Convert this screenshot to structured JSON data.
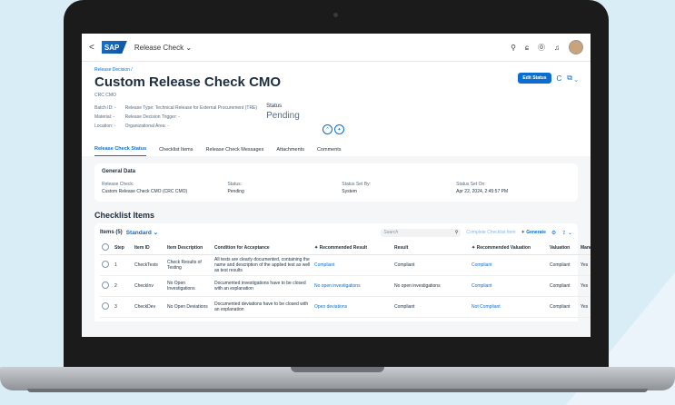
{
  "shell": {
    "back": "<",
    "logo": "SAP",
    "app_title": "Release Check ⌄",
    "icons": [
      "search-icon",
      "copilot-icon",
      "help-icon",
      "bell-icon",
      "avatar"
    ]
  },
  "header": {
    "breadcrumb": "Release Decision /",
    "title": "Custom Release Check CMO",
    "subtitle": "CRC CMO",
    "col1": [
      "Batch ID:  -",
      "Material:  -",
      "Location:  -"
    ],
    "col2": [
      "Release Type:  Technical Release for External Procurement (TRE)",
      "Release Decision Trigger:  -",
      "Organizational Area:  -"
    ],
    "status_label": "Status",
    "status_value": "Pending",
    "edit_button": "Edit Status",
    "refresh_icon": "C",
    "share_icon": "⧉ ⌄",
    "collapse_icons": [
      "^",
      "✦"
    ]
  },
  "tabs": [
    "Release Check Status",
    "Checklist Items",
    "Release Check Messages",
    "Attachments",
    "Comments"
  ],
  "general": {
    "title": "General Data",
    "fields": [
      {
        "label": "Release Check:",
        "value": "Custom Release Check CMO (CRC CMO)"
      },
      {
        "label": "Status:",
        "value": "Pending"
      },
      {
        "label": "Status Set By:",
        "value": "System"
      },
      {
        "label": "Status Set On:",
        "value": "Apr 22, 2024, 2:45:57 PM"
      }
    ]
  },
  "checklist": {
    "section_title": "Checklist Items",
    "items_count": "Items (5)",
    "variant": "Standard ⌄",
    "search_placeholder": "Search",
    "complete_btn": "Complete Checklist Item",
    "generate_btn": "Generate",
    "columns": [
      "",
      "Step",
      "Item ID",
      "Item Description",
      "Condition for Acceptance",
      "✦ Recommended Result",
      "Result",
      "✦ Recommended Valuation",
      "Valuation",
      "Mandatory"
    ],
    "rows": [
      {
        "step": "1",
        "id": "CheckTests",
        "desc": "Check Results of Testing",
        "cond": "All tests are clearly documented, containing the name and description of the applied test as well as test results",
        "rec_result": "Compliant",
        "result": "Compliant",
        "rec_val": "Compliant",
        "val": "Compliant",
        "mand": "Yes"
      },
      {
        "step": "2",
        "id": "CheckInv",
        "desc": "No Open Investigations",
        "cond": "Documented investigations have to be closed with an explanation",
        "rec_result": "No open investigations",
        "result": "No open investigations",
        "rec_val": "Compliant",
        "val": "Compliant",
        "mand": "Yes"
      },
      {
        "step": "3",
        "id": "CheckDev",
        "desc": "No Open Deviations",
        "cond": "Documented deviations have to be closed with an explanation",
        "rec_result": "Open deviations",
        "result": "Compliant",
        "rec_val": "Not Compliant",
        "val": "Compliant",
        "mand": "Yes"
      }
    ]
  }
}
